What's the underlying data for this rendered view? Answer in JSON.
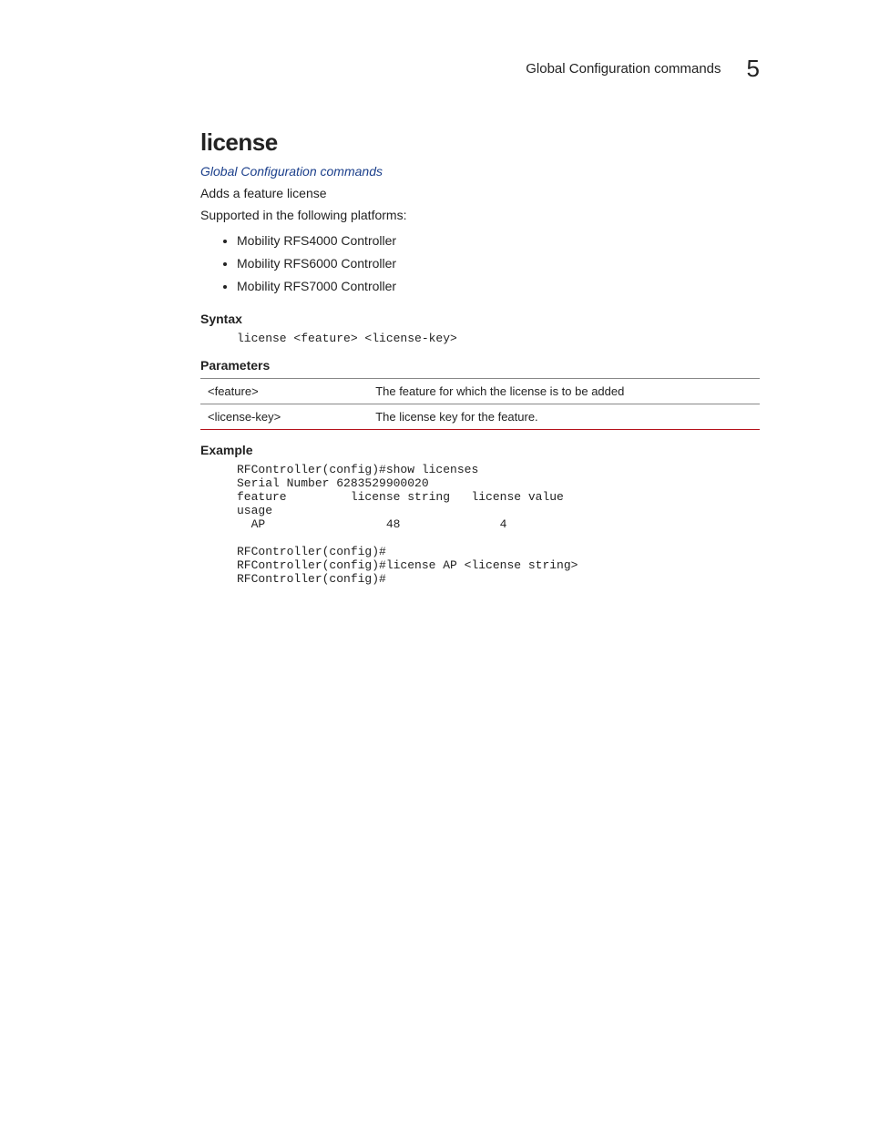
{
  "header": {
    "section": "Global Configuration commands",
    "chapter_number": "5"
  },
  "title": "license",
  "link_text": "Global Configuration commands",
  "description": "Adds a feature license",
  "supported_text": "Supported in the following platforms:",
  "platforms": [
    "Mobility RFS4000 Controller",
    "Mobility RFS6000 Controller",
    "Mobility RFS7000 Controller"
  ],
  "syntax_heading": "Syntax",
  "syntax_code": "license <feature> <license-key>",
  "parameters_heading": "Parameters",
  "parameters": [
    {
      "name": "<feature>",
      "desc": "The feature for which the license is to be added"
    },
    {
      "name": "<license-key>",
      "desc": "The license key for the feature."
    }
  ],
  "example_heading": "Example",
  "example_code": "RFController(config)#show licenses\nSerial Number 6283529900020\nfeature         license string   license value                 \nusage\n  AP                 48              4\n\nRFController(config)#\nRFController(config)#license AP <license string>\nRFController(config)#"
}
